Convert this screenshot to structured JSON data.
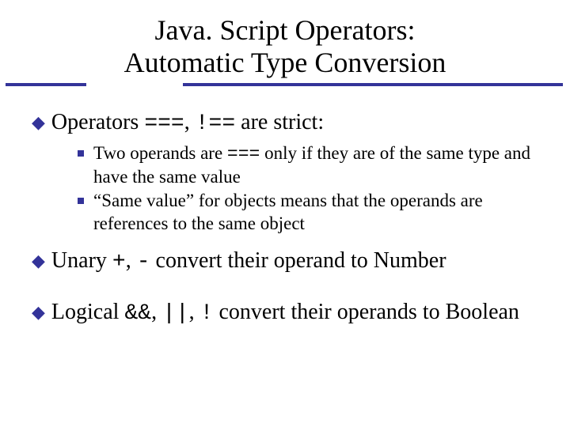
{
  "title": {
    "line1": "Java. Script Operators:",
    "line2": "Automatic Type Conversion"
  },
  "items": [
    {
      "pre": "Operators ",
      "code": "===",
      "mid": ", ",
      "code2": "!==",
      "post": " are strict:",
      "subs": [
        {
          "pre": "Two  operands are ",
          "code": "===",
          "post": " only if they are of the same type and have the same value"
        },
        {
          "pre": "“Same value” for objects means that the operands are references to the same object"
        }
      ]
    },
    {
      "pre": "Unary ",
      "code": "+",
      "mid": ", ",
      "code2": "-",
      "post": " convert their operand to Number"
    },
    {
      "pre": "Logical ",
      "code": "&&",
      "mid": ", ",
      "code2": "||",
      "mid2": ", ",
      "code3": "!",
      "post": " convert their operands to Boolean"
    }
  ]
}
